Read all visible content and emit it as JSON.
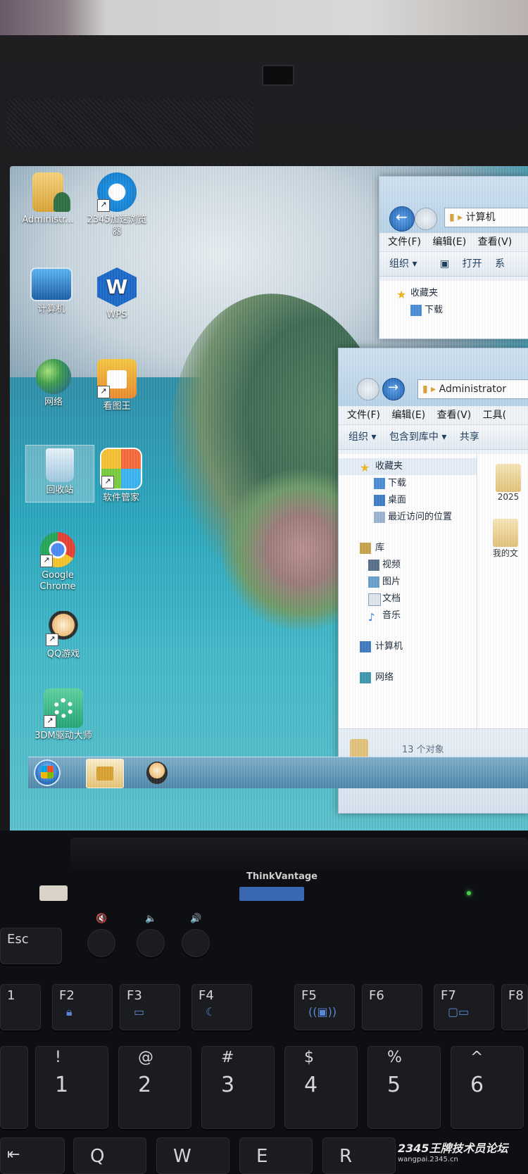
{
  "desktop": {
    "icons": [
      {
        "name": "administrator-folder",
        "label": "Administr..."
      },
      {
        "name": "browser-2345",
        "label": "2345加速浏览器"
      },
      {
        "name": "computer",
        "label": "计算机"
      },
      {
        "name": "wps",
        "label": "WPS"
      },
      {
        "name": "network",
        "label": "网络"
      },
      {
        "name": "image-viewer",
        "label": "看图王"
      },
      {
        "name": "recycle-bin",
        "label": "回收站"
      },
      {
        "name": "software-manager",
        "label": "软件管家"
      },
      {
        "name": "google-chrome",
        "label": "Google Chrome"
      },
      {
        "name": "qq-games",
        "label": "QQ游戏"
      },
      {
        "name": "3dm-driver",
        "label": "3DM驱动大师"
      }
    ]
  },
  "window_computer": {
    "address": "计算机",
    "menu": [
      "文件(F)",
      "编辑(E)",
      "查看(V)"
    ],
    "toolbar": [
      "组织 ▾",
      "打开",
      "系"
    ],
    "nav": [
      "收藏夹",
      "下载"
    ]
  },
  "window_admin": {
    "address": "Administrator",
    "menu": [
      "文件(F)",
      "编辑(E)",
      "查看(V)",
      "工具("
    ],
    "toolbar": [
      "组织 ▾",
      "包含到库中 ▾",
      "共享"
    ],
    "nav": {
      "favorites": "收藏夹",
      "favorites_items": [
        "下载",
        "桌面",
        "最近访问的位置"
      ],
      "libraries": "库",
      "library_items": [
        "视频",
        "图片",
        "文档",
        "音乐"
      ],
      "computer": "计算机",
      "network": "网络"
    },
    "files": [
      "2025",
      "我的文"
    ],
    "status": "13 个对象"
  },
  "keyboard": {
    "esc": "Esc",
    "thinkvantage": "ThinkVantage",
    "fn_keys": [
      "1",
      "F2",
      "F3",
      "F4",
      "F5",
      "F6",
      "F7",
      "F8"
    ],
    "number_keys": [
      {
        "top": "!",
        "main": "1"
      },
      {
        "top": "@",
        "main": "2"
      },
      {
        "top": "#",
        "main": "3"
      },
      {
        "top": "$",
        "main": "4"
      },
      {
        "top": "%",
        "main": "5"
      },
      {
        "top": "^",
        "main": "6"
      }
    ],
    "letter_keys": [
      "Q",
      "W",
      "E",
      "R"
    ]
  },
  "watermark": {
    "title": "2345王牌技术员论坛",
    "url": "wangpai.2345.cn"
  }
}
